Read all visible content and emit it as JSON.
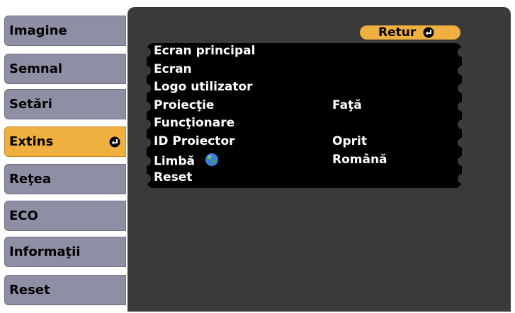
{
  "tabs": [
    {
      "label": "Imagine",
      "active": false
    },
    {
      "label": "Semnal",
      "active": false
    },
    {
      "label": "Setări",
      "active": false
    },
    {
      "label": "Extins",
      "active": true
    },
    {
      "label": "Reţea",
      "active": false
    },
    {
      "label": "ECO",
      "active": false
    },
    {
      "label": "Informaţii",
      "active": false
    },
    {
      "label": "Reset",
      "active": false
    }
  ],
  "return_button": {
    "label": "Retur",
    "icon": "enter-icon"
  },
  "menu": [
    {
      "label": "Ecran principal",
      "value": ""
    },
    {
      "label": "Ecran",
      "value": ""
    },
    {
      "label": "Logo utilizator",
      "value": ""
    },
    {
      "label": "Proiecţie",
      "value": "Faţă"
    },
    {
      "label": "Funcţionare",
      "value": ""
    },
    {
      "label": "ID Proiector",
      "value": "Oprit"
    },
    {
      "label": "Limbă",
      "value": "Română",
      "icon": "globe-icon"
    },
    {
      "label": "Reset",
      "value": ""
    }
  ],
  "colors": {
    "tab": "#8e8ea4",
    "tab_active": "#f0b040",
    "panel": "#3a3a3a",
    "menu": "#000000",
    "text_light": "#ffffff"
  }
}
